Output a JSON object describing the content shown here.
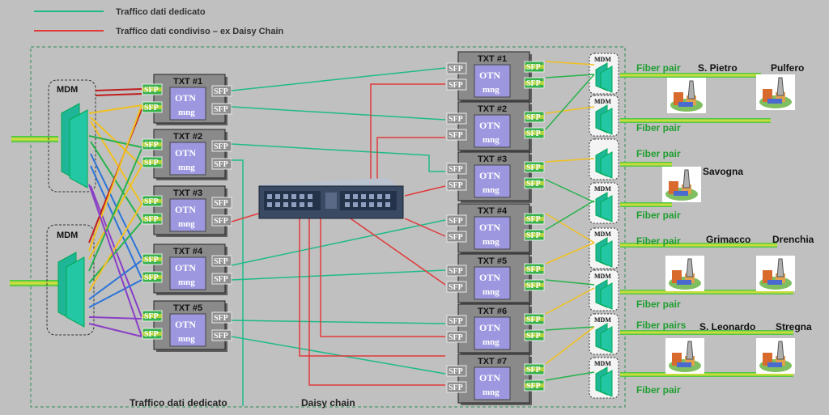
{
  "legend": {
    "dedicated": "Traffico dati dedicato",
    "shared": "Traffico dati condiviso  –  ex Daisy  Chain"
  },
  "colors": {
    "dedicated": "#1fba8a",
    "shared": "#e03a3a",
    "box": "#8a8a8a",
    "otn": "#9d97e0",
    "sfp_green": "#37b24d",
    "mdm": "#1fb597",
    "fiber_green": "#33c24a",
    "fiber_yellow": "#e7e13a"
  },
  "mdm_label": "MDM",
  "sfp_label": "SFP",
  "otn_label": "OTN",
  "mng_label": "mng",
  "left_txts": [
    "TXT #1",
    "TXT #2",
    "TXT #3",
    "TXT #4",
    "TXT #5"
  ],
  "right_txts": [
    "TXT #1",
    "TXT #2",
    "TXT #3",
    "TXT #4",
    "TXT #5",
    "TXT #6",
    "TXT #7"
  ],
  "fiber_labels": [
    "Fiber pair",
    "Fiber pair",
    "Fiber pair",
    "Fiber pair",
    "Fiber pair",
    "Fiber pair",
    "Fiber pairs",
    "Fiber pair"
  ],
  "sites": [
    "S. Pietro",
    "Pulfero",
    "Savogna",
    "Grimacco",
    "Drenchia",
    "S. Leonardo",
    "Stregna"
  ],
  "bottom_labels": {
    "dedicated": "Traffico dati dedicato",
    "daisy": "Daisy chain"
  }
}
